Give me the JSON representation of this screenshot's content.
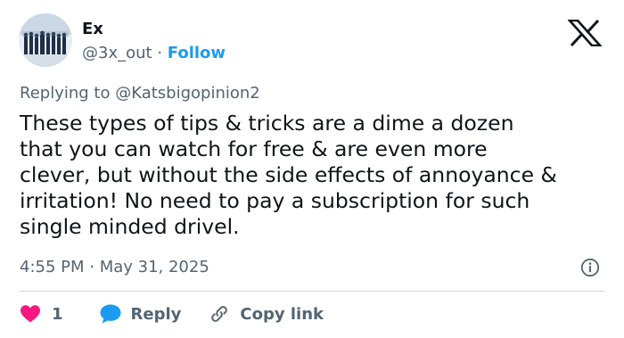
{
  "author": {
    "display_name": "Ex",
    "handle": "@3x_out",
    "separator": " · ",
    "follow_label": "Follow"
  },
  "reply_context": {
    "prefix": "Replying to ",
    "mention": "@Katsbigopinion2"
  },
  "tweet": {
    "text": "These types of tips & tricks  are a dime a dozen\nthat you can watch for free & are even more\nclever, but without the side effects of annoyance &\nirritation!  No need to pay a subscription for such\nsingle minded drivel.",
    "timestamp": "4:55 PM · May 31, 2025"
  },
  "actions": {
    "like_count": "1",
    "reply_label": "Reply",
    "copy_label": "Copy link"
  },
  "colors": {
    "text": "#0f1419",
    "secondary": "#536471",
    "link": "#1d9bf0",
    "like": "#f91880",
    "reply_bubble": "#1d9bf0",
    "divider": "#cfd9de"
  },
  "icons": {
    "brand": "x-logo-icon",
    "info": "info-icon",
    "like": "heart-icon",
    "reply": "speech-bubble-icon",
    "copy": "link-icon"
  }
}
